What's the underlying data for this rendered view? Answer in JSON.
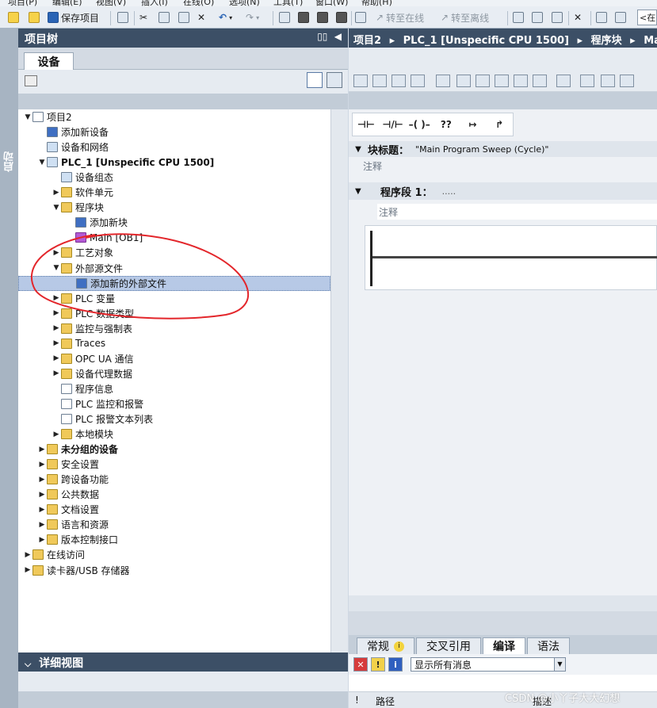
{
  "menubar": {
    "items": [
      "项目(P)",
      "编辑(E)",
      "视图(V)",
      "插入(I)",
      "在线(O)",
      "选项(N)",
      "工具(T)",
      "窗口(W)",
      "帮助(H)"
    ]
  },
  "toolbar": {
    "save_label": "保存项目",
    "go_online": "转至在线",
    "go_offline": "转至离线",
    "search_placeholder": "<在"
  },
  "sidebar": {
    "vertical_label": "启动"
  },
  "project_tree": {
    "title": "项目树",
    "tab": "设备",
    "items": [
      {
        "label": "项目2",
        "arrow": "▼",
        "icon": "doc",
        "indent": 0
      },
      {
        "label": "添加新设备",
        "arrow": "",
        "icon": "star",
        "indent": 1
      },
      {
        "label": "设备和网络",
        "arrow": "",
        "icon": "network",
        "indent": 1
      },
      {
        "label": "PLC_1 [Unspecific CPU 1500]",
        "arrow": "▼",
        "icon": "plc",
        "indent": 1,
        "bold": true
      },
      {
        "label": "设备组态",
        "arrow": "",
        "icon": "config",
        "indent": 2
      },
      {
        "label": "软件单元",
        "arrow": "▶",
        "icon": "folder",
        "indent": 2
      },
      {
        "label": "程序块",
        "arrow": "▼",
        "icon": "folder",
        "indent": 2
      },
      {
        "label": "添加新块",
        "arrow": "",
        "icon": "star",
        "indent": 3
      },
      {
        "label": "Main [OB1]",
        "arrow": "",
        "icon": "ob",
        "indent": 3
      },
      {
        "label": "工艺对象",
        "arrow": "▶",
        "icon": "folder",
        "indent": 2
      },
      {
        "label": "外部源文件",
        "arrow": "▼",
        "icon": "folder",
        "indent": 2
      },
      {
        "label": "添加新的外部文件",
        "arrow": "",
        "icon": "star",
        "indent": 3,
        "selected": true
      },
      {
        "label": "PLC 变量",
        "arrow": "▶",
        "icon": "folder",
        "indent": 2
      },
      {
        "label": "PLC 数据类型",
        "arrow": "▶",
        "icon": "folder",
        "indent": 2
      },
      {
        "label": "监控与强制表",
        "arrow": "▶",
        "icon": "folder",
        "indent": 2
      },
      {
        "label": "Traces",
        "arrow": "▶",
        "icon": "folder",
        "indent": 2
      },
      {
        "label": "OPC UA 通信",
        "arrow": "▶",
        "icon": "folder",
        "indent": 2
      },
      {
        "label": "设备代理数据",
        "arrow": "▶",
        "icon": "folder",
        "indent": 2
      },
      {
        "label": "程序信息",
        "arrow": "",
        "icon": "doc",
        "indent": 2
      },
      {
        "label": "PLC 监控和报警",
        "arrow": "",
        "icon": "doc",
        "indent": 2
      },
      {
        "label": "PLC 报警文本列表",
        "arrow": "",
        "icon": "doc",
        "indent": 2
      },
      {
        "label": "本地模块",
        "arrow": "▶",
        "icon": "folder",
        "indent": 2
      },
      {
        "label": "未分组的设备",
        "arrow": "▶",
        "icon": "folder",
        "indent": 1,
        "bold": true
      },
      {
        "label": "安全设置",
        "arrow": "▶",
        "icon": "folder",
        "indent": 1
      },
      {
        "label": "跨设备功能",
        "arrow": "▶",
        "icon": "folder",
        "indent": 1
      },
      {
        "label": "公共数据",
        "arrow": "▶",
        "icon": "folder",
        "indent": 1
      },
      {
        "label": "文档设置",
        "arrow": "▶",
        "icon": "folder",
        "indent": 1
      },
      {
        "label": "语言和资源",
        "arrow": "▶",
        "icon": "folder",
        "indent": 1
      },
      {
        "label": "版本控制接口",
        "arrow": "▶",
        "icon": "folder",
        "indent": 1
      },
      {
        "label": "在线访问",
        "arrow": "▶",
        "icon": "folder",
        "indent": 0
      },
      {
        "label": "读卡器/USB 存储器",
        "arrow": "▶",
        "icon": "folder",
        "indent": 0
      }
    ]
  },
  "detail_view": {
    "title": "详细视图"
  },
  "breadcrumb": {
    "parts": [
      "项目2",
      "▸",
      "PLC_1 [Unspecific CPU 1500]",
      "▸",
      "程序块",
      "▸",
      "Main"
    ]
  },
  "editor": {
    "ladder_buttons": [
      "⊣⊢",
      "⊣/⊢",
      "–( )–",
      "??",
      "↦",
      "↱"
    ],
    "block_title_label": "块标题：",
    "block_title_value": "\"Main Program Sweep (Cycle)\"",
    "comment_label": "注释",
    "network_label": "程序段 1：",
    "network_dots": ".....",
    "network_comment": "注释"
  },
  "inspector": {
    "tabs": [
      "常规",
      "交叉引用",
      "编译",
      "语法"
    ],
    "active_tab": "编译",
    "filter_value": "显示所有消息",
    "col_excl": "!",
    "col_path": "路径",
    "col_desc": "描述"
  },
  "watermark": "CSDN @小丫子大大幻想"
}
